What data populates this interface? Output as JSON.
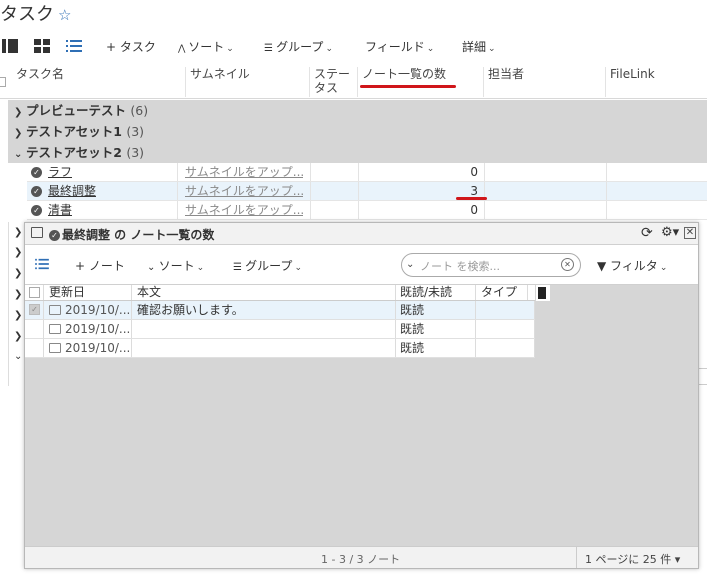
{
  "header": {
    "title": "タスク",
    "star": "☆"
  },
  "toolbar": {
    "add_task": "タスク",
    "sort": "ソート",
    "group": "グループ",
    "fields": "フィールド",
    "details": "詳細"
  },
  "grid": {
    "columns": [
      "タスク名",
      "サムネイル",
      "ステー\nタス",
      "ノート一覧の数",
      "担当者",
      "FileLink"
    ],
    "groups": [
      {
        "name": "プレビューテスト",
        "count": "(6)"
      },
      {
        "name": "テストアセット1",
        "count": "(3)"
      },
      {
        "name": "テストアセット2",
        "count": "(3)"
      }
    ],
    "tasks": [
      {
        "name": "ラフ",
        "thumbnail": "サムネイルをアップ...",
        "notes": "0"
      },
      {
        "name": "最終調整",
        "thumbnail": "サムネイルをアップ...",
        "notes": "3"
      },
      {
        "name": "清書",
        "thumbnail": "サムネイルをアップ...",
        "notes": "0"
      }
    ]
  },
  "panel": {
    "title": "最終調整 の ノート一覧の数",
    "toolbar": {
      "add_note": "ノート",
      "sort": "ソート",
      "group": "グループ",
      "filter": "フィルタ"
    },
    "search": {
      "placeholder": "ノート を検索..."
    },
    "columns": [
      "更新日",
      "本文",
      "既読/未読",
      "タイプ"
    ],
    "notes": [
      {
        "date": "2019/10/...",
        "body": "確認お願いします。",
        "status": "既読"
      },
      {
        "date": "2019/10/...",
        "body": "",
        "status": "既読"
      },
      {
        "date": "2019/10/...",
        "body": "",
        "status": "既読"
      }
    ],
    "footer": {
      "count": "1 - 3 / 3 ノート",
      "per_page": "1 ページに 25 件"
    }
  },
  "colors": {
    "accent": "#2f6fb5",
    "highlight": "#d0161a",
    "selected_row": "#e9f3fb",
    "group_bg": "#d6d6d6"
  }
}
